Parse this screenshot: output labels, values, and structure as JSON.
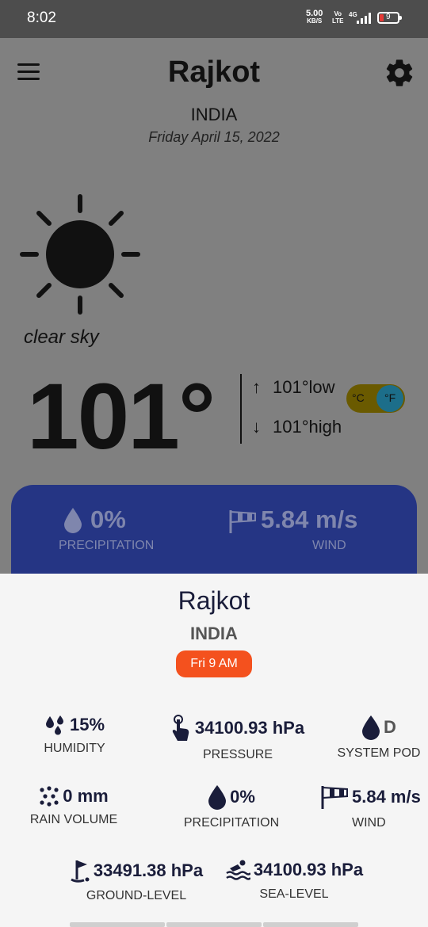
{
  "status_bar": {
    "time": "8:02",
    "net_speed": "5.00",
    "net_unit": "KB/S",
    "volte_top": "Vo",
    "volte_bottom": "LTE",
    "signal": "4G",
    "battery": "9"
  },
  "header": {
    "city": "Rajkot",
    "country": "INDIA",
    "date": "Friday April 15, 2022"
  },
  "current": {
    "icon": "sun-icon",
    "condition": "clear sky",
    "temperature": "101°",
    "low": "101°low",
    "high": "101°high",
    "unit_c": "°C",
    "unit_f": "°F",
    "selected_unit": "°F"
  },
  "summary_card": {
    "precipitation_value": "0%",
    "precipitation_label": "PRECIPITATION",
    "wind_value": "5.84 m/s",
    "wind_label": "WIND"
  },
  "detail_sheet": {
    "city": "Rajkot",
    "country": "INDIA",
    "time_pill": "Fri 9 AM",
    "humidity_value": "15%",
    "humidity_label": "HUMIDITY",
    "pressure_value": "34100.93 hPa",
    "pressure_label": "PRESSURE",
    "system_pod_value": "D",
    "system_pod_label": "SYSTEM POD",
    "rain_volume_value": "0 mm",
    "rain_volume_label": "RAIN VOLUME",
    "precipitation_value": "0%",
    "precipitation_label": "PRECIPITATION",
    "wind_value": "5.84 m/s",
    "wind_label": "WIND",
    "ground_level_value": "33491.38 hPa",
    "ground_level_label": "GROUND-LEVEL",
    "sea_level_value": "34100.93 hPa",
    "sea_level_label": "SEA-LEVEL"
  },
  "colors": {
    "accent_blue": "#253584",
    "pill_orange": "#f4511e",
    "text_dark": "#1a1d3a"
  }
}
